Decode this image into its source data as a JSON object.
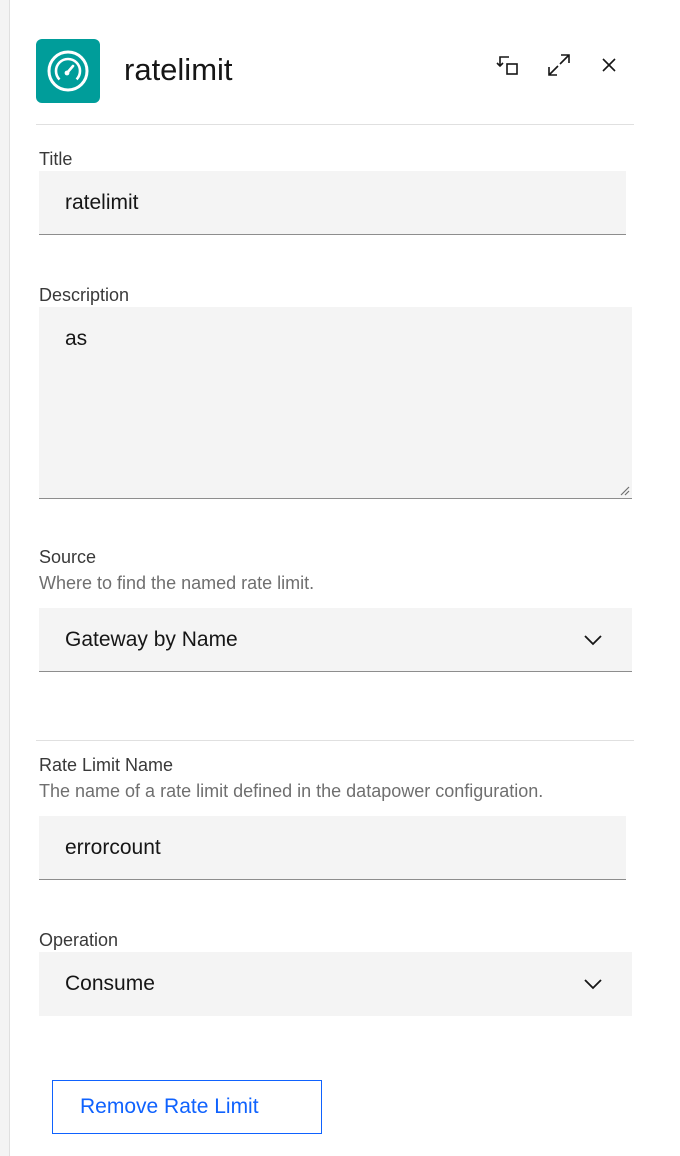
{
  "header": {
    "title": "ratelimit",
    "icon": "speedometer-icon",
    "accent_color": "#009d9a"
  },
  "form": {
    "title": {
      "label": "Title",
      "value": "ratelimit"
    },
    "description": {
      "label": "Description",
      "value": "as"
    },
    "source": {
      "label": "Source",
      "helper": "Where to find the named rate limit.",
      "selected": "Gateway by Name"
    },
    "rate_limit_name": {
      "label": "Rate Limit Name",
      "helper": "The name of a rate limit defined in the datapower configuration.",
      "value": "errorcount"
    },
    "operation": {
      "label": "Operation",
      "selected": "Consume"
    },
    "remove_button": "Remove Rate Limit"
  }
}
